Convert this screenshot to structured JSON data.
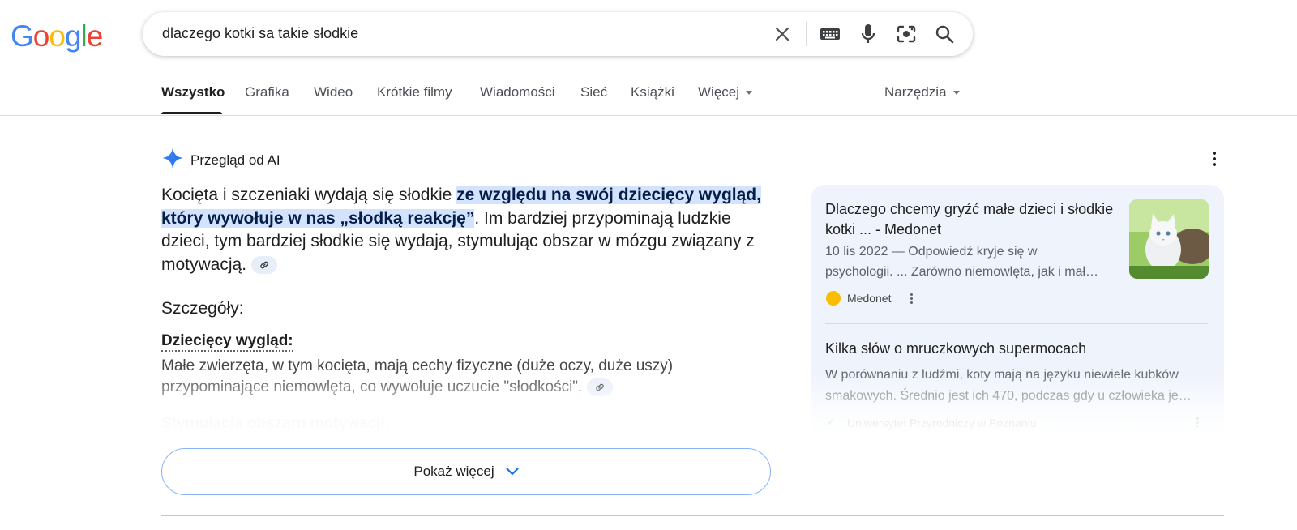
{
  "logo": {
    "letters": [
      "G",
      "o",
      "o",
      "g",
      "l",
      "e"
    ]
  },
  "search": {
    "query": "dlaczego kotki sa takie słodkie"
  },
  "tabs": [
    {
      "label": "Wszystko"
    },
    {
      "label": "Grafika"
    },
    {
      "label": "Wideo"
    },
    {
      "label": "Krótkie filmy"
    },
    {
      "label": "Wiadomości"
    },
    {
      "label": "Sieć"
    },
    {
      "label": "Książki"
    },
    {
      "label": "Więcej"
    }
  ],
  "tools_label": "Narzędzia",
  "ai_overview": {
    "title": "Przegląd od AI",
    "intro_plain": "Kocięta i szczeniaki wydają się słodkie ",
    "intro_highlight": "ze względu na swój dziecięcy wygląd, który wywołuje w nas „słodką reakcję”",
    "intro_rest": ". Im bardziej przypominają ludzkie dzieci, tym bardziej słodkie się wydają, stymulując obszar w mózgu związany z motywacją.",
    "details_title": "Szczegóły:",
    "detail1_label": "Dziecięcy wygląd:",
    "detail1_text": "Małe zwierzęta, w tym kocięta, mają cechy fizyczne (duże oczy, duże uszy) przypominające niemowlęta, co wywołuje uczucie \"słodkości\".",
    "detail2_label": "Stymulacja obszaru motywacji:",
    "show_more": "Pokaż więcej"
  },
  "sources": [
    {
      "title": "Dlaczego chcemy gryźć małe dzieci i słodkie kotki ... - Medonet",
      "snippet_line1": "10 lis 2022 — Odpowiedź kryje się w",
      "snippet_line2": "psychologii. ... Zarówno niemowlęta, jak i mał…",
      "site": "Medonet"
    },
    {
      "title": "Kilka słów o mruczkowych supermocach",
      "snippet_line1": "W porównaniu z ludźmi, koty mają na języku niewiele kubków",
      "snippet_line2": "smakowych. Średnio jest ich 470, podczas gdy u człowieka je…",
      "site": "Uniwersytet Przyrodniczy w Poznaniu"
    }
  ],
  "colors": {
    "accent_blue": "#4285f4",
    "highlight_bg": "#d3e3fd",
    "panel_bg": "#eef3fc",
    "medonet_dot": "#fbbc04"
  },
  "icons": [
    "close-icon",
    "keyboard-icon",
    "mic-icon",
    "lens-icon",
    "search-icon",
    "ai-sparkle-icon",
    "link-icon",
    "more-vert-icon",
    "chevron-down-icon"
  ]
}
